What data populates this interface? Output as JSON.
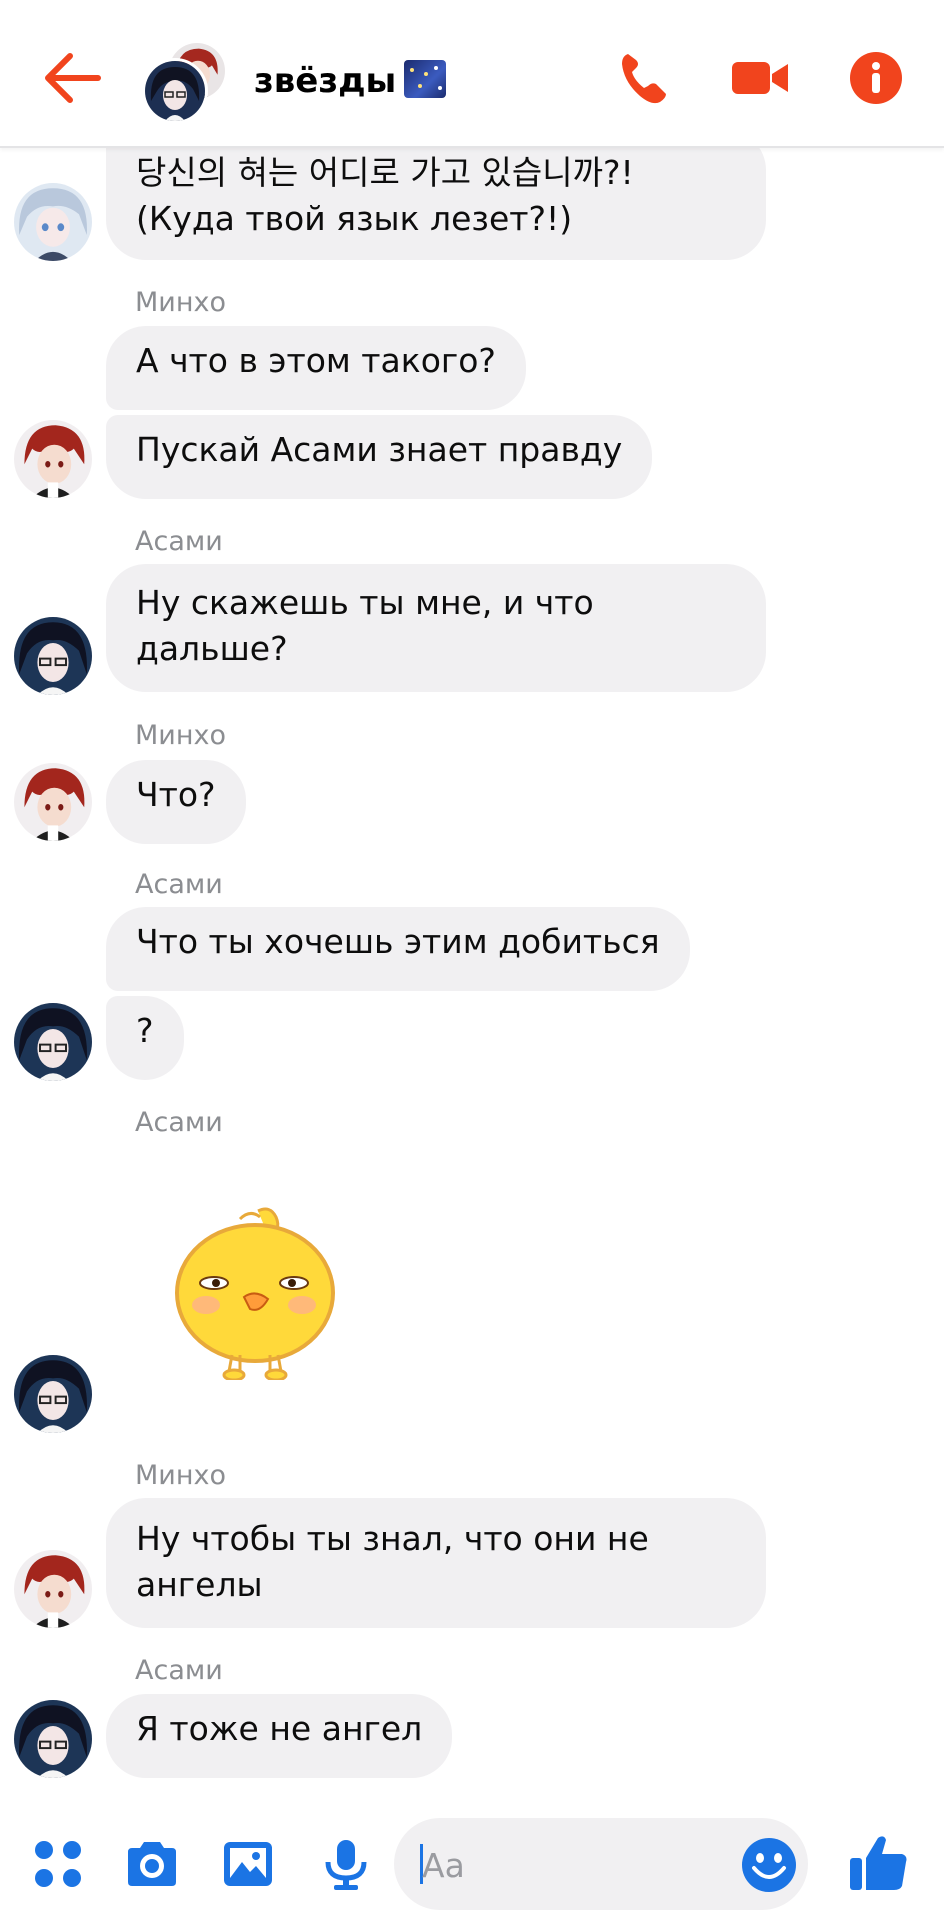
{
  "header": {
    "title": "звёзды",
    "title_emoji": "night-sky-emoji",
    "accent_color": "#f1441d"
  },
  "messages": [
    {
      "type": "text",
      "sender": "",
      "lines": [
        "당신의 혀는 어디로 가고 있습니까?!",
        "(Куда твой язык лезет?!)"
      ]
    },
    {
      "type": "label",
      "text": "Минхо"
    },
    {
      "type": "text",
      "sender": "Минхо",
      "lines": [
        "А что в этом такого?"
      ]
    },
    {
      "type": "text",
      "sender": "Минхо",
      "lines": [
        "Пускай Асами знает правду"
      ]
    },
    {
      "type": "label",
      "text": "Асами"
    },
    {
      "type": "text",
      "sender": "Асами",
      "lines": [
        "Ну скажешь ты мне, и что",
        "дальше?"
      ]
    },
    {
      "type": "label",
      "text": "Минхо"
    },
    {
      "type": "text",
      "sender": "Минхо",
      "lines": [
        "Что?"
      ]
    },
    {
      "type": "label",
      "text": "Асами"
    },
    {
      "type": "text",
      "sender": "Асами",
      "lines": [
        "Что ты хочешь этим добиться"
      ]
    },
    {
      "type": "text",
      "sender": "Асами",
      "lines": [
        "?"
      ]
    },
    {
      "type": "label",
      "text": "Асами"
    },
    {
      "type": "sticker",
      "sender": "Асами",
      "icon": "yellow-chick-sticker"
    },
    {
      "type": "label",
      "text": "Минхо"
    },
    {
      "type": "text",
      "sender": "Минхо",
      "lines": [
        "Ну чтобы ты знал, что они не",
        "ангелы"
      ]
    },
    {
      "type": "label",
      "text": "Асами"
    },
    {
      "type": "text",
      "sender": "Асами",
      "lines": [
        "Я тоже не ангел"
      ]
    }
  ],
  "composer": {
    "placeholder": "Aa",
    "value": "",
    "accent_color": "#1b74e4"
  }
}
